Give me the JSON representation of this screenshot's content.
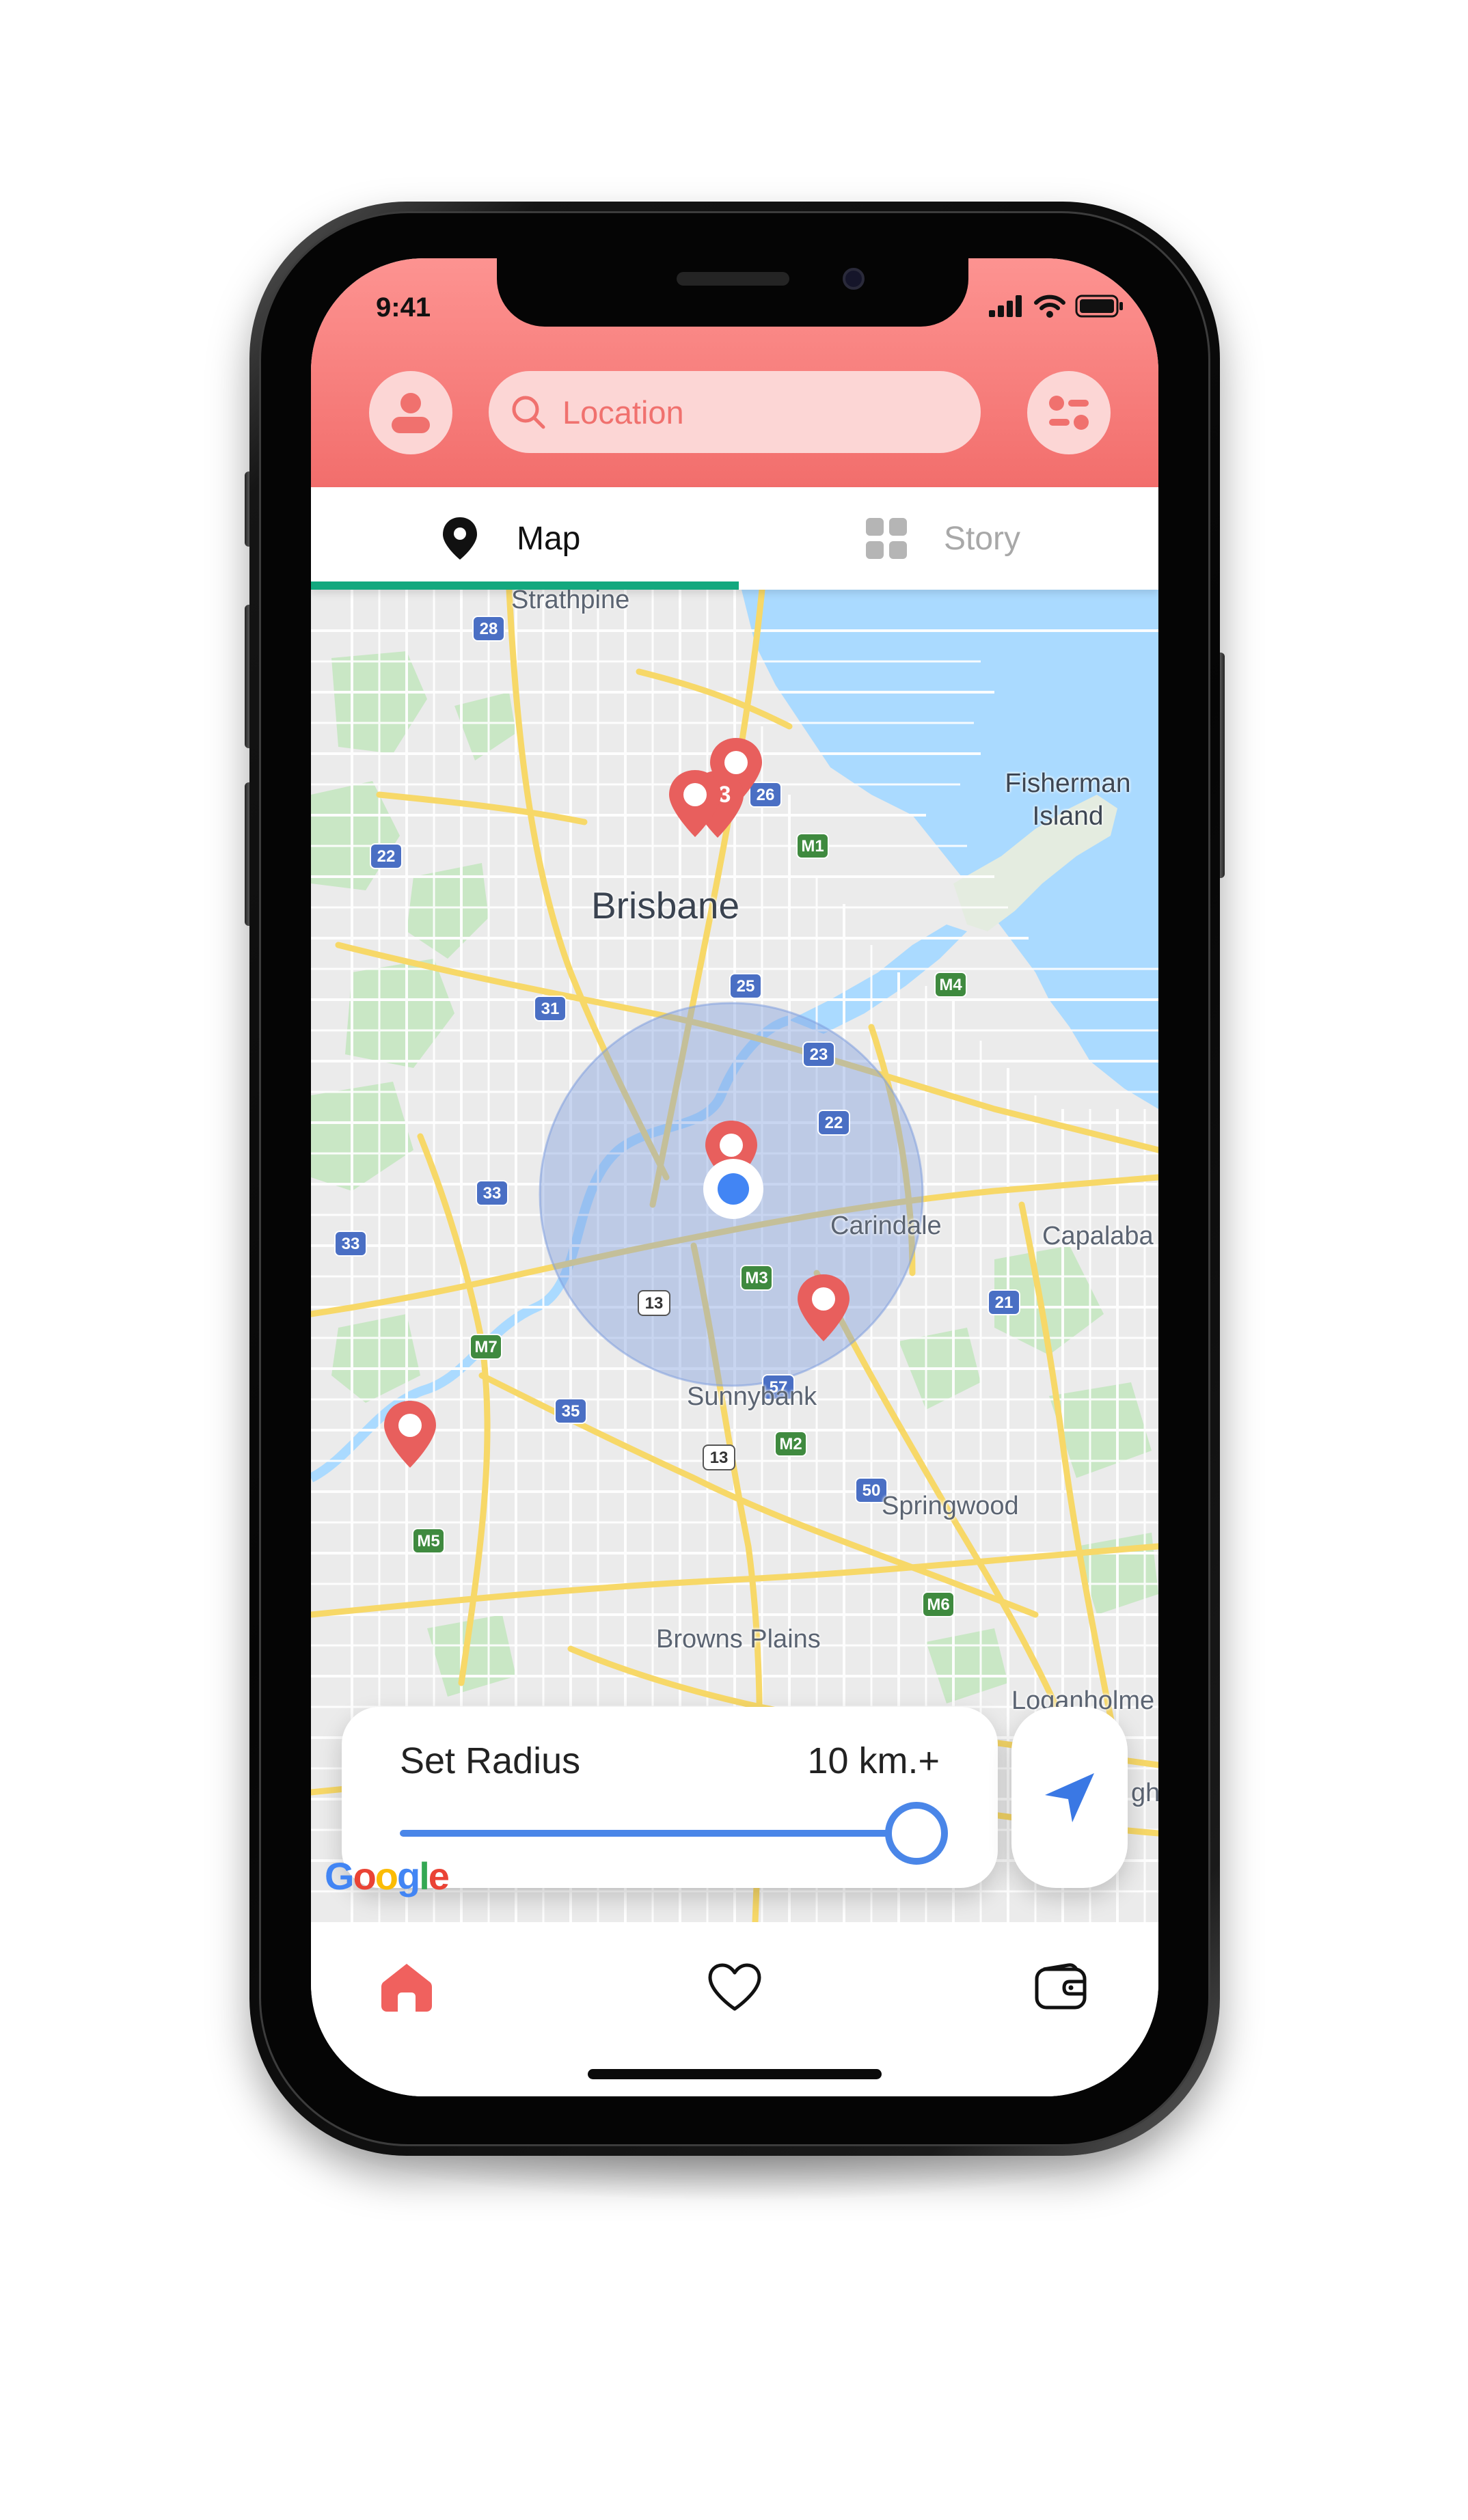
{
  "status_bar": {
    "time": "9:41"
  },
  "header": {
    "search": {
      "placeholder": "Location"
    },
    "profile_icon": "user-icon",
    "filter_icon": "filter-toggle-icon"
  },
  "tabs": [
    {
      "label": "Map",
      "icon": "map-pin-icon",
      "active": true
    },
    {
      "label": "Story",
      "icon": "grid-icon",
      "active": false
    }
  ],
  "map": {
    "labels": {
      "strathpine": "Strathpine",
      "fisherman_island": "Fisherman Island",
      "brisbane": "Brisbane",
      "carindale": "Carindale",
      "capalaba": "Capalaba",
      "sunnybank": "Sunnybank",
      "springwood": "Springwood",
      "browns_plains": "Browns Plains",
      "loganholme": "Loganholme",
      "partial_label": "gh"
    },
    "road_shields": {
      "r28": "28",
      "r26": "26",
      "m1": "M1",
      "r22a": "22",
      "r25": "25",
      "r31": "31",
      "m4": "M4",
      "r23": "23",
      "r22b": "22",
      "r33a": "33",
      "r33b": "33",
      "m3": "M3",
      "r13a": "13",
      "r21": "21",
      "m7": "M7",
      "r57": "57",
      "r35": "35",
      "r13b": "13",
      "m2": "M2",
      "r50": "50",
      "m5": "M5",
      "m6": "M6"
    },
    "cluster_count": "3",
    "attribution": "Google"
  },
  "radius_panel": {
    "title": "Set Radius",
    "value_label": "10 km.+",
    "slider_fraction": 1.0
  },
  "bottom_nav": [
    {
      "name": "home",
      "icon": "home-icon",
      "active": true
    },
    {
      "name": "favorites",
      "icon": "heart-icon",
      "active": false
    },
    {
      "name": "wallet",
      "icon": "wallet-icon",
      "active": false
    }
  ],
  "colors": {
    "header_top": "#fd9391",
    "header_bottom": "#f26e6c",
    "accent_red": "#e85f5d",
    "tab_underline": "#13a87e",
    "slider_blue": "#4a86e8",
    "water": "#aadaff",
    "map_bg": "#ebebeb"
  }
}
